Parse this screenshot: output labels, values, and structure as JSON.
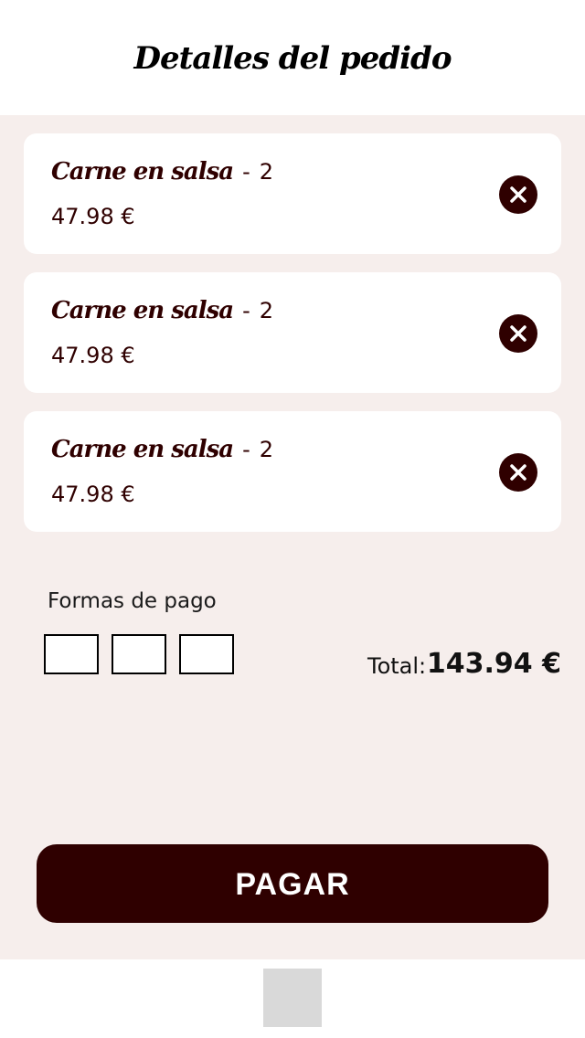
{
  "header": {
    "title": "Detalles del pedido"
  },
  "orders": [
    {
      "name": "Carne en salsa",
      "separator": "-",
      "quantity": "2",
      "price": "47.98 €"
    },
    {
      "name": "Carne en salsa",
      "separator": "-",
      "quantity": "2",
      "price": "47.98 €"
    },
    {
      "name": "Carne en salsa",
      "separator": "-",
      "quantity": "2",
      "price": "47.98 €"
    }
  ],
  "payment": {
    "label": "Formas de pago",
    "options": [
      "",
      "",
      ""
    ]
  },
  "summary": {
    "total_label": "Total:",
    "total_value": "143.94 €"
  },
  "actions": {
    "pay_label": "PAGAR"
  },
  "icons": {
    "remove": "close-circle-icon"
  },
  "colors": {
    "accent": "#2f0000",
    "background": "#f6eeec",
    "card": "#ffffff",
    "footer_placeholder": "#d9d9d9"
  }
}
